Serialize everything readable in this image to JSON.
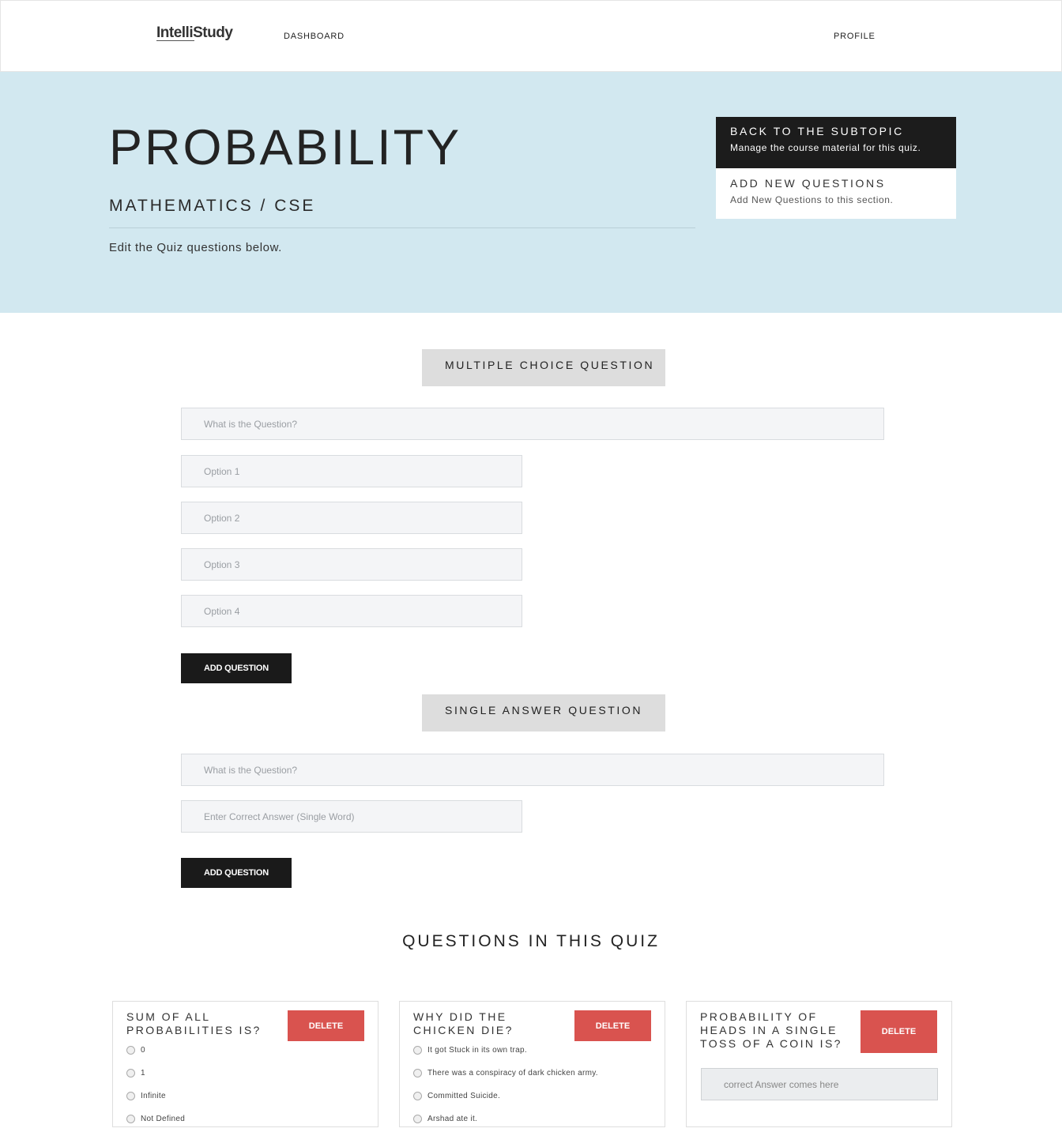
{
  "nav": {
    "brand": "IntelliStudy",
    "dashboard": "DASHBOARD",
    "profile": "PROFILE"
  },
  "hero": {
    "title": "PROBABILITY",
    "subtitle": "MATHEMATICS / CSE",
    "description": "Edit the Quiz questions below.",
    "actions": [
      {
        "title": "BACK TO THE SUBTOPIC",
        "subtitle": "Manage the course material for this quiz."
      },
      {
        "title": "ADD NEW QUESTIONS",
        "subtitle": "Add New Questions to this section."
      }
    ]
  },
  "mcq": {
    "heading": "MULTIPLE CHOICE QUESTION",
    "question_placeholder": "What is the Question?",
    "options": [
      {
        "placeholder": "Option 1"
      },
      {
        "placeholder": "Option 2"
      },
      {
        "placeholder": "Option 3"
      },
      {
        "placeholder": "Option 4"
      }
    ],
    "submit_label": "ADD QUESTION"
  },
  "single": {
    "heading": "SINGLE ANSWER QUESTION",
    "question_placeholder": "What is the Question?",
    "answer_placeholder": "Enter Correct Answer (Single Word)",
    "submit_label": "ADD QUESTION"
  },
  "quiz_list": {
    "title": "QUESTIONS IN THIS QUIZ",
    "delete_label": "DELETE",
    "cards": [
      {
        "question": "Sum of all probabilities is?",
        "options": [
          "0",
          "1",
          "Infinite",
          "Not Defined"
        ]
      },
      {
        "question": "Why did the chicken die?",
        "options": [
          "It got Stuck in its own trap.",
          "There was a conspiracy of dark chicken army.",
          "Committed Suicide.",
          "Arshad ate it."
        ]
      },
      {
        "question": "Probability of heads in a single toss of a coin is?",
        "answer_placeholder": "correct Answer comes here"
      }
    ]
  }
}
